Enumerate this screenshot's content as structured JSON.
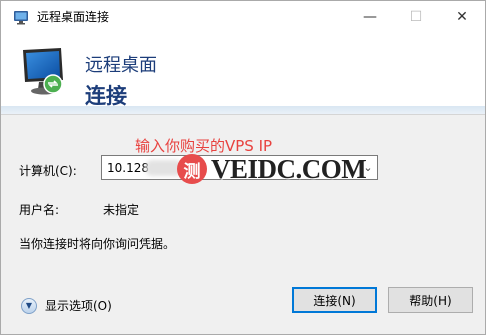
{
  "window": {
    "title": "远程桌面连接",
    "minimize_icon": "minimize-icon",
    "maximize_icon": "maximize-icon",
    "close_icon": "close-icon"
  },
  "banner": {
    "line1": "远程桌面",
    "line2": "连接",
    "icon": "remote-desktop-monitor-icon"
  },
  "annotation": "输入你购买的VPS IP",
  "watermark": {
    "badge": "测",
    "text": "VEIDC.COM"
  },
  "form": {
    "computer_label": "计算机(C):",
    "computer_value": "10.128",
    "user_label": "用户名:",
    "user_value": "未指定",
    "info": "当你连接时将向你询问凭据。"
  },
  "options": {
    "label": "显示选项(O)",
    "icon": "expand-chevron-icon"
  },
  "buttons": {
    "connect": "连接(N)",
    "help": "帮助(H)"
  },
  "colors": {
    "accent": "#0078d7",
    "banner_text": "#1c3d7a",
    "annotation": "#e8423f",
    "window_bg": "#f0f0f0"
  }
}
